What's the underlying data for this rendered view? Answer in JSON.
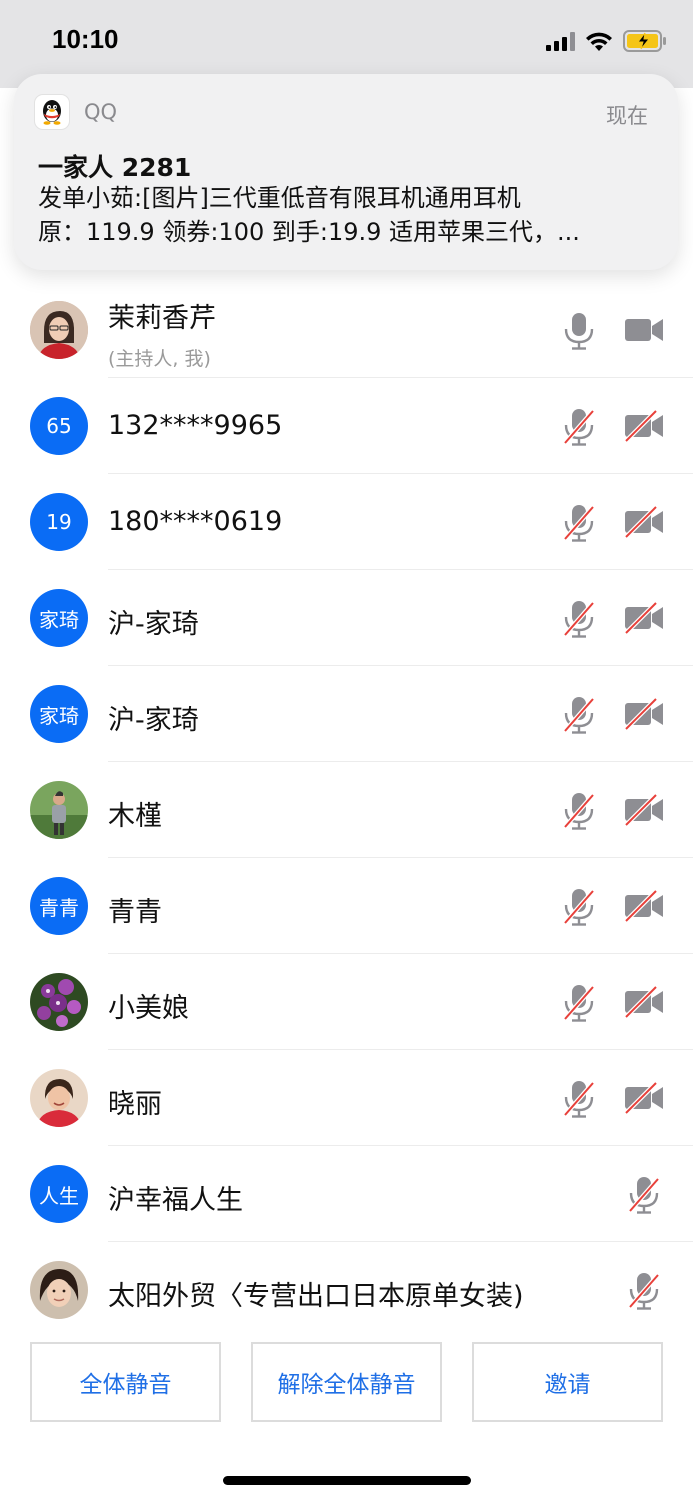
{
  "status_bar": {
    "time": "10:10"
  },
  "notification": {
    "app_name": "QQ",
    "time": "现在",
    "title": "一家人 2281",
    "line1": "发单小茹:[图片]三代重低音有限耳机通用耳机",
    "line2": "原：119.9 领券:100 到手:19.9 适用苹果三代，..."
  },
  "participants": [
    {
      "avatar_type": "photo",
      "name": "茉莉香芹",
      "subtitle": "(主持人, 我)",
      "mic": "on",
      "cam": "on"
    },
    {
      "avatar_type": "text",
      "avatar_text": "65",
      "name": "132****9965",
      "mic": "muted",
      "cam": "off"
    },
    {
      "avatar_type": "text",
      "avatar_text": "19",
      "name": "180****0619",
      "mic": "muted",
      "cam": "off"
    },
    {
      "avatar_type": "text",
      "avatar_text": "家琦",
      "name": "沪-家琦",
      "mic": "muted",
      "cam": "off"
    },
    {
      "avatar_type": "text",
      "avatar_text": "家琦",
      "name": "沪-家琦",
      "mic": "muted",
      "cam": "off"
    },
    {
      "avatar_type": "photo",
      "name": "木槿",
      "mic": "muted",
      "cam": "off"
    },
    {
      "avatar_type": "text",
      "avatar_text": "青青",
      "name": "青青",
      "mic": "muted",
      "cam": "off"
    },
    {
      "avatar_type": "photo",
      "name": "小美娘",
      "mic": "muted",
      "cam": "off"
    },
    {
      "avatar_type": "photo",
      "name": "晓丽",
      "mic": "muted",
      "cam": "off"
    },
    {
      "avatar_type": "text",
      "avatar_text": "人生",
      "name": "沪幸福人生",
      "mic": "muted",
      "cam": "none"
    },
    {
      "avatar_type": "photo",
      "name": "太阳外贸〈专营出口日本原单女装)",
      "mic": "muted",
      "cam": "none"
    }
  ],
  "buttons": {
    "mute_all": "全体静音",
    "unmute_all": "解除全体静音",
    "invite": "邀请"
  },
  "colors": {
    "accent": "#0a6cf5",
    "button_text": "#1f6fe6",
    "muted_slash": "#e8403a",
    "icon_gray": "#8e8e93"
  }
}
